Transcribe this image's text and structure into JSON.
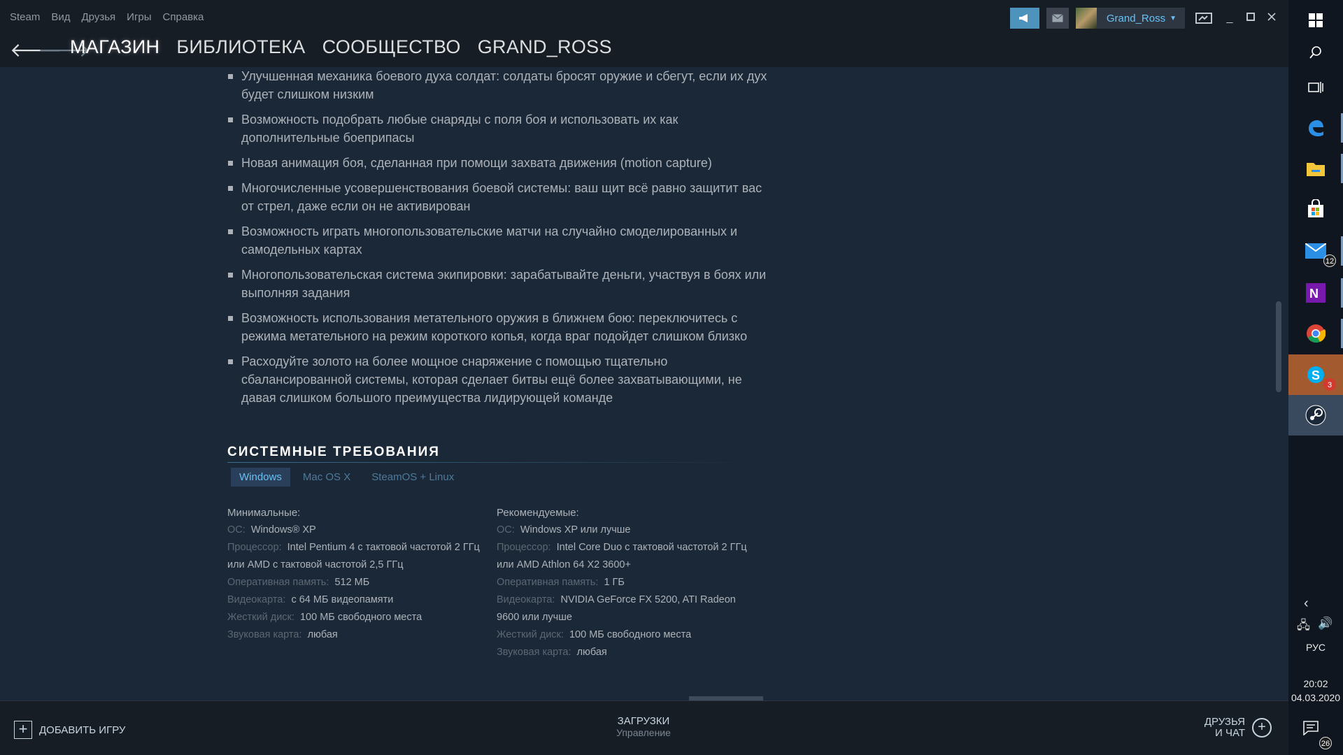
{
  "menu": [
    "Steam",
    "Вид",
    "Друзья",
    "Игры",
    "Справка"
  ],
  "account": {
    "name": "Grand_Ross"
  },
  "nav": {
    "links": [
      "МАГАЗИН",
      "БИБЛИОТЕКА",
      "СООБЩЕСТВО",
      "GRAND_ROSS"
    ]
  },
  "features": [
    "Улучшенная механика боевого духа солдат: солдаты бросят оружие и сбегут, если их дух будет слишком низким",
    "Возможность подобрать любые снаряды с поля боя и использовать их как дополнительные боеприпасы",
    "Новая анимация боя, сделанная при помощи захвата движения (motion capture)",
    "Многочисленные усовершенствования боевой системы: ваш щит всё равно защитит вас от стрел, даже если он не активирован",
    "Возможность играть многопользовательские матчи на случайно смоделированных и самодельных картах",
    "Многопользовательская система экипировки: зарабатывайте деньги, участвуя в боях или выполняя задания",
    "Возможность использования метательного оружия в ближнем бою: переключитесь с режима метательного на режим короткого копья, когда враг подойдет слишком близко",
    "Расходуйте золото на более мощное снаряжение с помощью тщательно сбалансированной системы, которая сделает битвы ещё более захватывающими, не давая слишком большого преимущества лидирующей команде"
  ],
  "sysreq": {
    "title": "СИСТЕМНЫЕ ТРЕБОВАНИЯ",
    "tabs": [
      "Windows",
      "Mac OS X",
      "SteamOS + Linux"
    ],
    "minimum": {
      "heading": "Минимальные:",
      "rows": [
        {
          "key": "ОС:",
          "value": "Windows® XP"
        },
        {
          "key": "Процессор:",
          "value": "Intel Pentium 4 с тактовой частотой 2 ГГц или AMD с тактовой частотой 2,5 ГГц"
        },
        {
          "key": "Оперативная память:",
          "value": "512 МБ"
        },
        {
          "key": "Видеокарта:",
          "value": "с 64 МБ видеопамяти"
        },
        {
          "key": "Жесткий диск:",
          "value": "100 МБ свободного места"
        },
        {
          "key": "Звуковая карта:",
          "value": "любая"
        }
      ]
    },
    "recommended": {
      "heading": "Рекомендуемые:",
      "rows": [
        {
          "key": "ОС:",
          "value": "Windows XP или лучше"
        },
        {
          "key": "Процессор:",
          "value": "Intel Core Duo с тактовой частотой 2 ГГц или AMD Athlon 64 X2 3600+"
        },
        {
          "key": "Оперативная память:",
          "value": "1 ГБ"
        },
        {
          "key": "Видеокарта:",
          "value": "NVIDIA GeForce FX 5200, ATI Radeon 9600 или лучше"
        },
        {
          "key": "Жесткий диск:",
          "value": "100 МБ свободного места"
        },
        {
          "key": "Звуковая карта:",
          "value": "любая"
        }
      ]
    }
  },
  "bottom": {
    "add_game": "ДОБАВИТЬ ИГРУ",
    "downloads": "ЗАГРУЗКИ",
    "downloads_sub": "Управление",
    "friends_line1": "ДРУЗЬЯ",
    "friends_line2": "И ЧАТ"
  },
  "taskbar": {
    "mail_badge": "12",
    "skype_badge": "3",
    "lang": "РУС",
    "time": "20:02",
    "date": "04.03.2020",
    "notif_badge": "26"
  },
  "colors": {
    "accent": "#67c1f5",
    "background": "#1b2838",
    "chrome": "#171d25"
  }
}
